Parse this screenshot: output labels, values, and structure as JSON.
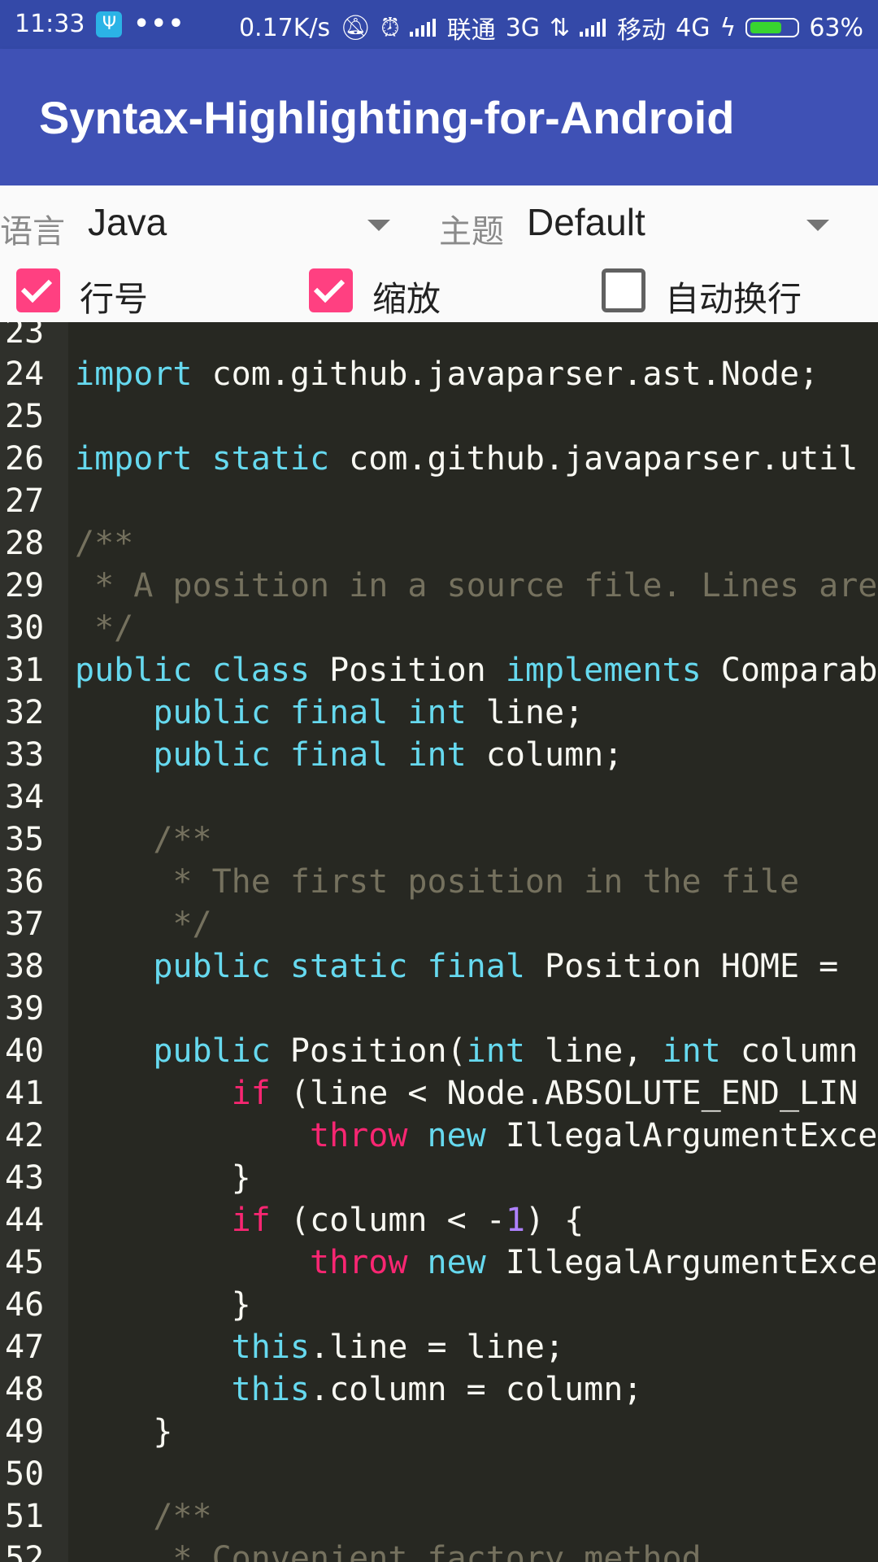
{
  "status": {
    "time": "11:33",
    "usb": "Ψ",
    "dots": "•••",
    "speed": "0.17K/s",
    "carrier1": "联通",
    "net1": "3G",
    "carrier2": "移动",
    "net2": "4G",
    "battery": "63%",
    "icons": [
      "usb-icon",
      "mute-icon",
      "alarm-icon",
      "signal-icon",
      "data-arrows-icon",
      "charging-icon",
      "battery-icon"
    ]
  },
  "appbar": {
    "title": "Syntax-Highlighting-for-Android"
  },
  "controls": {
    "language_label": "语言",
    "language_value": "Java",
    "theme_label": "主题",
    "theme_value": "Default",
    "line_numbers_label": "行号",
    "line_numbers_checked": true,
    "zoom_label": "缩放",
    "zoom_checked": true,
    "wrap_label": "自动换行",
    "wrap_checked": false
  },
  "colors": {
    "accent": "#FF4081",
    "primary": "#3F51B5",
    "status": "#3449A8",
    "editor_bg": "#272822",
    "keyword": "#66D9EF",
    "comment": "#75715E",
    "control": "#F92672",
    "number": "#AE81FF"
  },
  "code": {
    "first_line": 23,
    "lines": [
      [],
      [
        [
          "k",
          "import"
        ],
        [
          "p",
          " com.github.javaparser.ast.Node;"
        ]
      ],
      [],
      [
        [
          "k",
          "import"
        ],
        [
          "p",
          " "
        ],
        [
          "k",
          "static"
        ],
        [
          "p",
          " com.github.javaparser.util"
        ]
      ],
      [],
      [
        [
          "c",
          "/**"
        ]
      ],
      [
        [
          "c",
          " * A position in a source file. Lines are"
        ]
      ],
      [
        [
          "c",
          " */"
        ]
      ],
      [
        [
          "k",
          "public"
        ],
        [
          "p",
          " "
        ],
        [
          "k",
          "class"
        ],
        [
          "p",
          " Position "
        ],
        [
          "k",
          "implements"
        ],
        [
          "p",
          " Comparab"
        ]
      ],
      [
        [
          "p",
          "    "
        ],
        [
          "k",
          "public"
        ],
        [
          "p",
          " "
        ],
        [
          "k",
          "final"
        ],
        [
          "p",
          " "
        ],
        [
          "k",
          "int"
        ],
        [
          "p",
          " line;"
        ]
      ],
      [
        [
          "p",
          "    "
        ],
        [
          "k",
          "public"
        ],
        [
          "p",
          " "
        ],
        [
          "k",
          "final"
        ],
        [
          "p",
          " "
        ],
        [
          "k",
          "int"
        ],
        [
          "p",
          " column;"
        ]
      ],
      [],
      [
        [
          "c",
          "    /**"
        ]
      ],
      [
        [
          "c",
          "     * The first position in the file"
        ]
      ],
      [
        [
          "c",
          "     */"
        ]
      ],
      [
        [
          "p",
          "    "
        ],
        [
          "k",
          "public"
        ],
        [
          "p",
          " "
        ],
        [
          "k",
          "static"
        ],
        [
          "p",
          " "
        ],
        [
          "k",
          "final"
        ],
        [
          "p",
          " Position HOME = "
        ]
      ],
      [],
      [
        [
          "p",
          "    "
        ],
        [
          "k",
          "public"
        ],
        [
          "p",
          " Position("
        ],
        [
          "k",
          "int"
        ],
        [
          "p",
          " line, "
        ],
        [
          "k",
          "int"
        ],
        [
          "p",
          " column"
        ]
      ],
      [
        [
          "p",
          "        "
        ],
        [
          "r",
          "if"
        ],
        [
          "p",
          " (line < Node.ABSOLUTE_END_LIN"
        ]
      ],
      [
        [
          "p",
          "            "
        ],
        [
          "r",
          "throw"
        ],
        [
          "p",
          " "
        ],
        [
          "k",
          "new"
        ],
        [
          "p",
          " IllegalArgumentExce"
        ]
      ],
      [
        [
          "p",
          "        }"
        ]
      ],
      [
        [
          "p",
          "        "
        ],
        [
          "r",
          "if"
        ],
        [
          "p",
          " (column < -"
        ],
        [
          "n",
          "1"
        ],
        [
          "p",
          ") {"
        ]
      ],
      [
        [
          "p",
          "            "
        ],
        [
          "r",
          "throw"
        ],
        [
          "p",
          " "
        ],
        [
          "k",
          "new"
        ],
        [
          "p",
          " IllegalArgumentExce"
        ]
      ],
      [
        [
          "p",
          "        }"
        ]
      ],
      [
        [
          "p",
          "        "
        ],
        [
          "k",
          "this"
        ],
        [
          "p",
          ".line = line;"
        ]
      ],
      [
        [
          "p",
          "        "
        ],
        [
          "k",
          "this"
        ],
        [
          "p",
          ".column = column;"
        ]
      ],
      [
        [
          "p",
          "    }"
        ]
      ],
      [],
      [
        [
          "c",
          "    /**"
        ]
      ],
      [
        [
          "c",
          "     * Convenient factory method"
        ]
      ]
    ]
  }
}
